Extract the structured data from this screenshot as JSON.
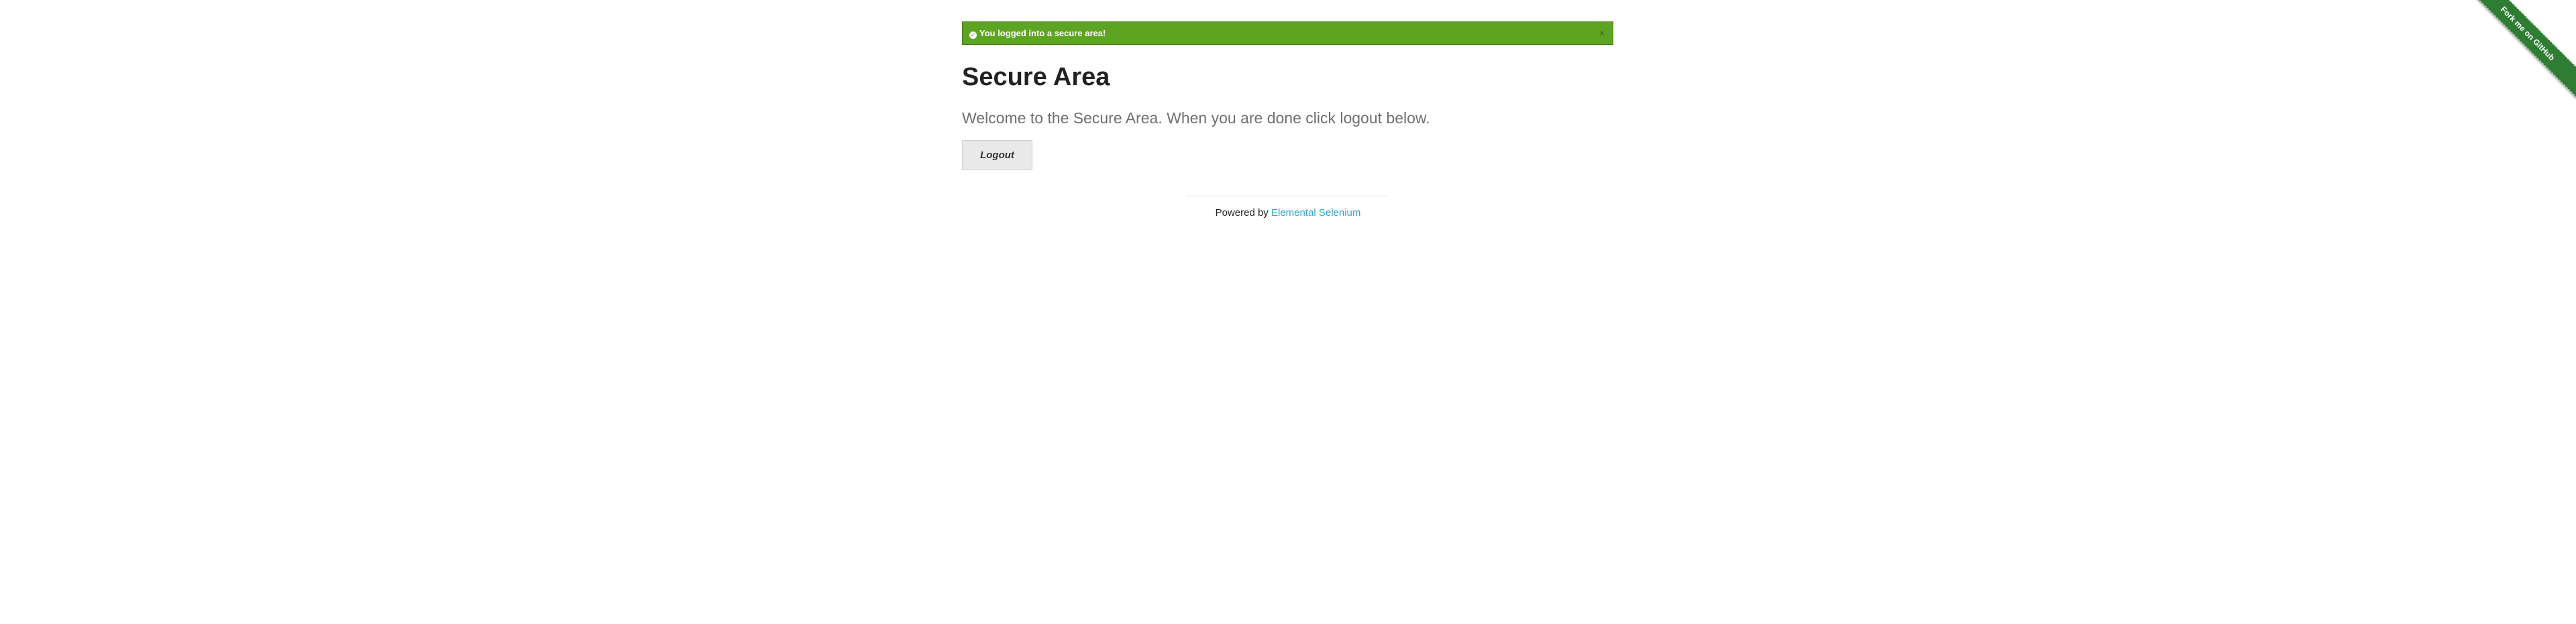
{
  "flash": {
    "message": "You logged into a secure area!",
    "close": "×",
    "icon": "check-circle-icon",
    "color": "#5da423"
  },
  "heading": "Secure Area",
  "subheader": "Welcome to the Secure Area. When you are done click logout below.",
  "logout_label": "Logout",
  "footer": {
    "prefix": "Powered by ",
    "link_text": "Elemental Selenium",
    "link_color": "#2ba6cb"
  },
  "ribbon": {
    "label": "Fork me on GitHub",
    "color": "#2f7d32"
  }
}
